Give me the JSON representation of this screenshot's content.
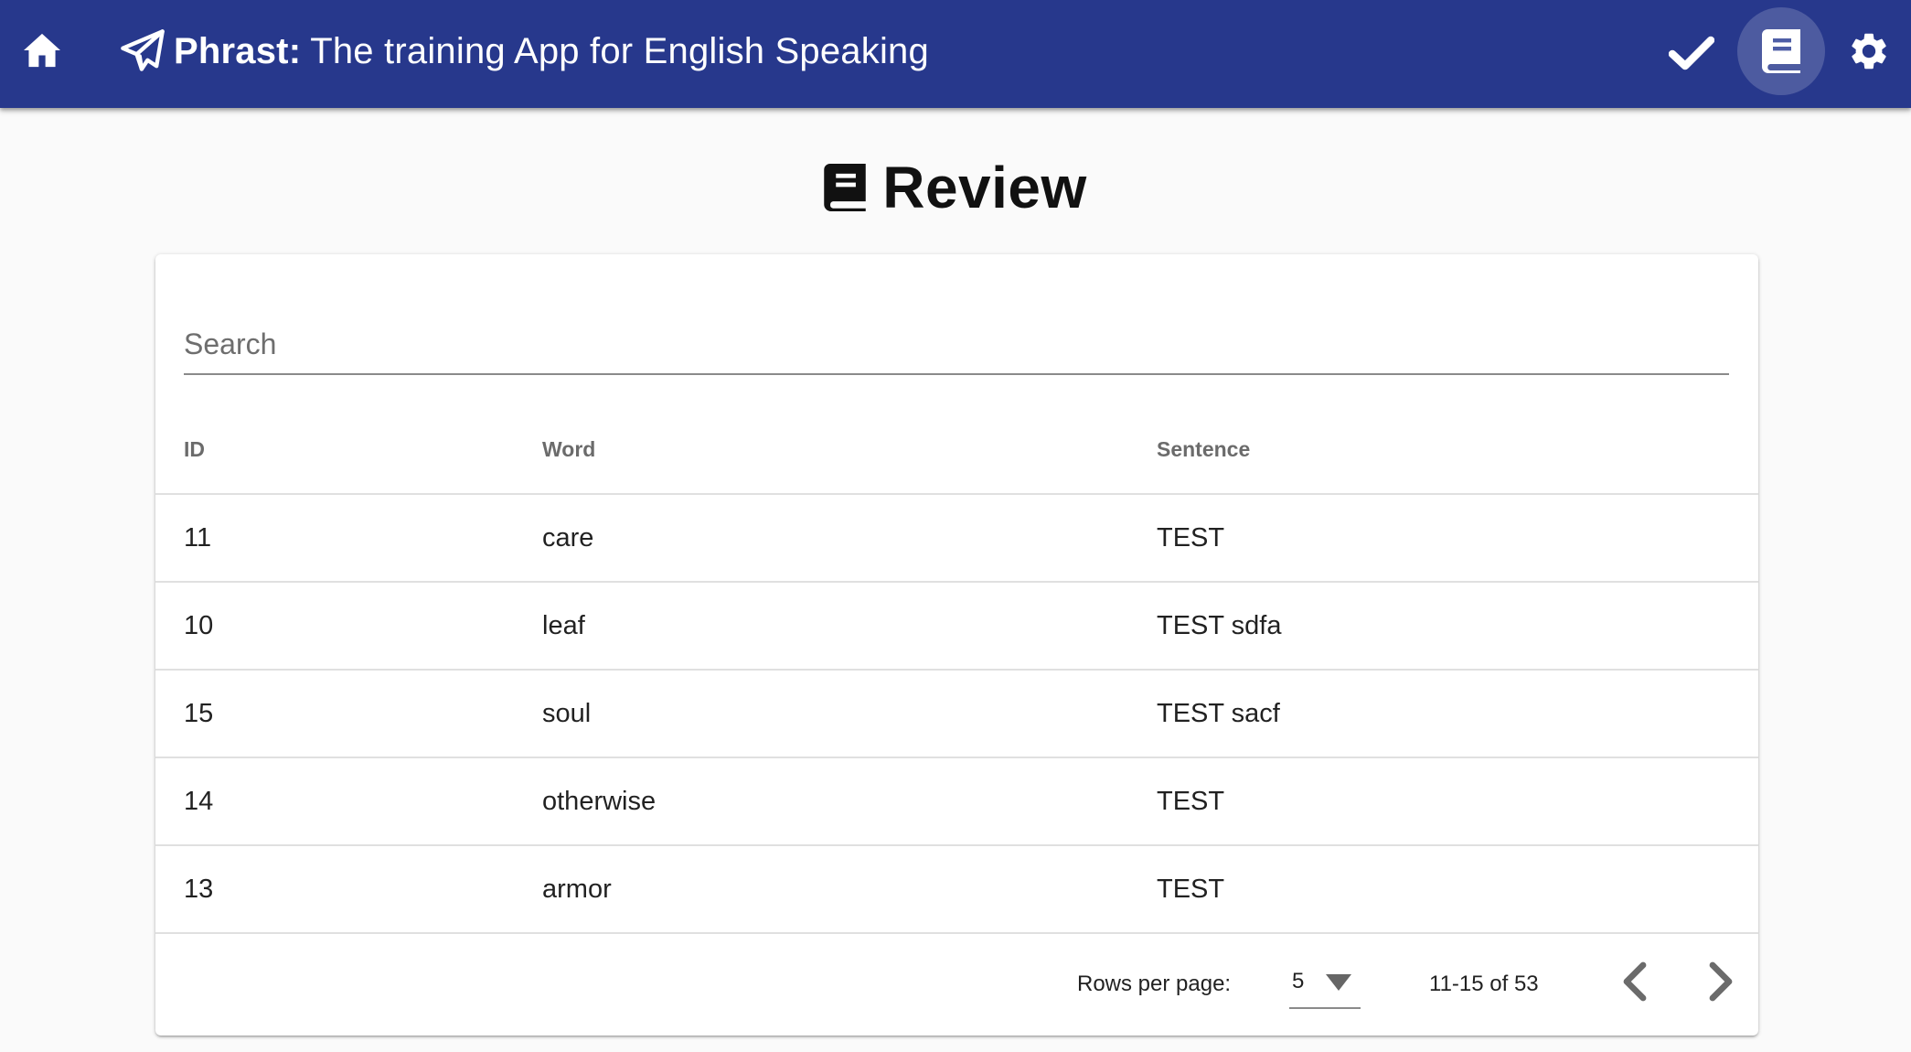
{
  "app": {
    "brand_name": "Phrast:",
    "tagline": "The training App for English Speaking"
  },
  "icons": {
    "home": "home-icon",
    "brand": "paper-plane-icon",
    "check": "check-icon",
    "review": "book-icon",
    "settings": "gear-icon",
    "select_caret": "caret-down-icon",
    "prev": "chevron-left-icon",
    "next": "chevron-right-icon"
  },
  "colors": {
    "appbar": "#27388c",
    "page_background": "#fafafa"
  },
  "page": {
    "title": "Review"
  },
  "search": {
    "placeholder": "Search",
    "value": ""
  },
  "table": {
    "columns": [
      "ID",
      "Word",
      "Sentence"
    ],
    "rows": [
      {
        "id": "11",
        "word": "care",
        "sentence": "TEST"
      },
      {
        "id": "10",
        "word": "leaf",
        "sentence": "TEST sdfa"
      },
      {
        "id": "15",
        "word": "soul",
        "sentence": "TEST sacf"
      },
      {
        "id": "14",
        "word": "otherwise",
        "sentence": "TEST"
      },
      {
        "id": "13",
        "word": "armor",
        "sentence": "TEST"
      }
    ]
  },
  "pagination": {
    "rows_per_page_label": "Rows per page:",
    "rows_per_page_value": "5",
    "range_text": "11-15 of 53"
  }
}
